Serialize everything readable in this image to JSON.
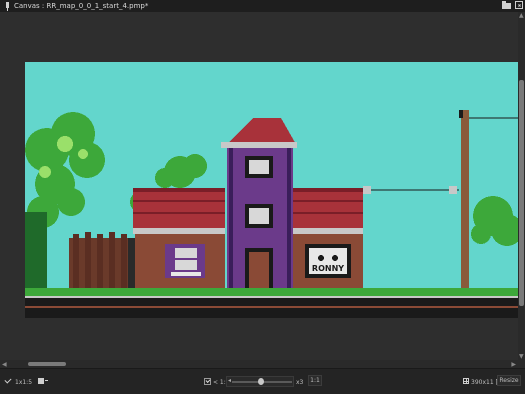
{
  "window": {
    "title": "Canvas : RR_map_0_0_1_start_4.pmp*"
  },
  "icons": {
    "pin": "pin-icon",
    "folder": "folder-icon",
    "close": "closebox-icon"
  },
  "canvas": {
    "sign_text": "RONNY",
    "colors": {
      "sky": "#63d6cc",
      "roof": "#a8323a",
      "brick": "#8a4a36",
      "purple": "#6b3a8a",
      "tree": "#3da83a",
      "ground": "#1a1a1a",
      "pole": "#8a5a3a"
    }
  },
  "statusbar": {
    "brush_size": "1x1:5",
    "zoom_label": "< 1:1",
    "zoom_factor": "x3",
    "zoom_reset": "1:1",
    "canvas_size": "390x11 [1]",
    "resize_label": "Resize"
  }
}
